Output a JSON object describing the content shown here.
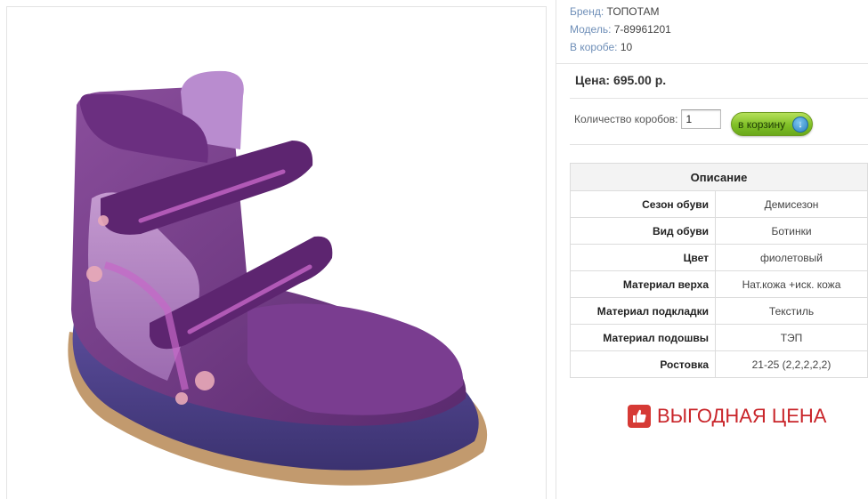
{
  "product": {
    "image_alt": "purple children's boot with velcro straps",
    "meta": [
      {
        "label": "Бренд:",
        "value": "ТОПОТАМ"
      },
      {
        "label": "Модель:",
        "value": "7-89961201"
      },
      {
        "label": "В коробе:",
        "value": "10"
      }
    ],
    "price_text": "Цена: 695.00 р."
  },
  "order": {
    "qty_label": "Количество коробов:",
    "qty_value": "1",
    "cart_label": "в корзину",
    "cart_icon": "down-arrow-circle-icon"
  },
  "description": {
    "title": "Описание",
    "rows": [
      {
        "name": "Сезон обуви",
        "value": "Демисезон"
      },
      {
        "name": "Вид обуви",
        "value": "Ботинки"
      },
      {
        "name": "Цвет",
        "value": "фиолетовый"
      },
      {
        "name": "Материал верха",
        "value": "Нат.кожа +иск. кожа"
      },
      {
        "name": "Материал подкладки",
        "value": "Текстиль"
      },
      {
        "name": "Материал подошвы",
        "value": "ТЭП"
      },
      {
        "name": "Ростовка",
        "value": "21-25 (2,2,2,2,2)"
      }
    ]
  },
  "promo": {
    "icon": "thumbs-up-icon",
    "text": "ВЫГОДНАЯ ЦЕНА"
  },
  "colors": {
    "link": "#6f8fb8",
    "promo": "#c9252a",
    "cart_button": "#7fbf26"
  }
}
